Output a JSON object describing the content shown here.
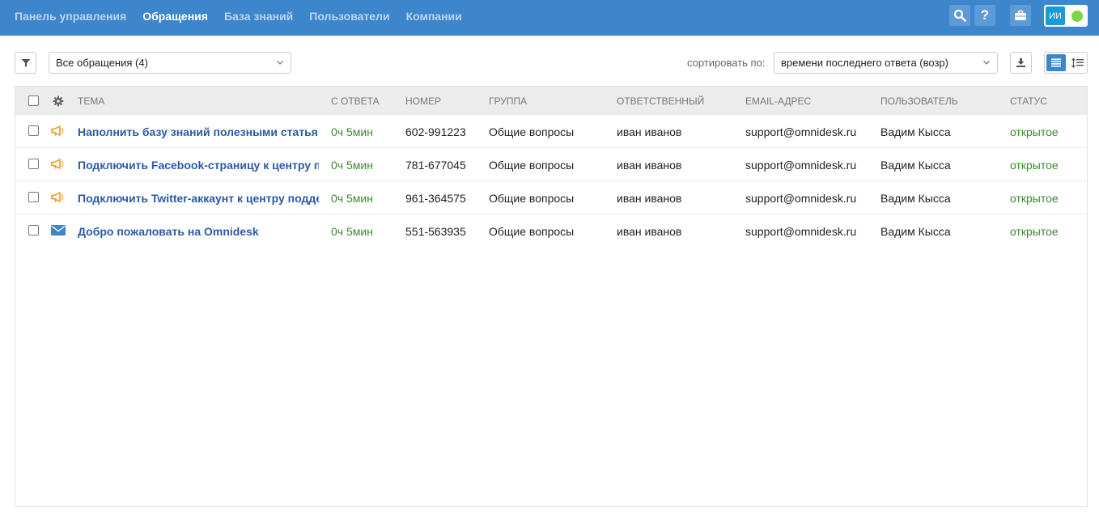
{
  "nav": {
    "items": [
      {
        "label": "Панель управления",
        "active": false
      },
      {
        "label": "Обращения",
        "active": true
      },
      {
        "label": "База знаний",
        "active": false
      },
      {
        "label": "Пользователи",
        "active": false
      },
      {
        "label": "Компании",
        "active": false
      }
    ],
    "icons": [
      "search-icon",
      "help-icon",
      "briefcase-icon"
    ]
  },
  "user": {
    "initials": "ИИ",
    "status": "online",
    "status_color": "#7ed34a"
  },
  "toolbar": {
    "filter_value": "Все обращения (4)",
    "sort_label": "сортировать по:",
    "sort_value": "времени последнего ответа (возр)"
  },
  "table": {
    "columns": [
      "ТЕМА",
      "С ОТВЕТА",
      "НОМЕР",
      "ГРУППА",
      "ОТВЕТСТВЕННЫЙ",
      "EMAIL-АДРЕС",
      "ПОЛЬЗОВАТЕЛЬ",
      "СТАТУС"
    ],
    "rows": [
      {
        "icon": "megaphone-icon",
        "subject": "Наполнить базу знаний полезными статьями",
        "since": "0ч 5мин",
        "number": "602-991223",
        "group": "Общие вопросы",
        "assignee": "иван иванов",
        "email": "support@omnidesk.ru",
        "user": "Вадим Кысса",
        "status": "открытое"
      },
      {
        "icon": "megaphone-icon",
        "subject": "Подключить Facebook-страницу к центру поддержки",
        "since": "0ч 5мин",
        "number": "781-677045",
        "group": "Общие вопросы",
        "assignee": "иван иванов",
        "email": "support@omnidesk.ru",
        "user": "Вадим Кысса",
        "status": "открытое"
      },
      {
        "icon": "megaphone-icon",
        "subject": "Подключить Twitter-аккаунт к центру поддержки",
        "since": "0ч 5мин",
        "number": "961-364575",
        "group": "Общие вопросы",
        "assignee": "иван иванов",
        "email": "support@omnidesk.ru",
        "user": "Вадим Кысса",
        "status": "открытое"
      },
      {
        "icon": "envelope-icon",
        "subject": "Добро пожаловать на Omnidesk",
        "since": "0ч 5мин",
        "number": "551-563935",
        "group": "Общие вопросы",
        "assignee": "иван иванов",
        "email": "support@omnidesk.ru",
        "user": "Вадим Кысса",
        "status": "открытое"
      }
    ]
  },
  "colors": {
    "topbar": "#3d86cc",
    "link": "#2a5aa8",
    "status_open": "#3a8a2e",
    "megaphone": "#f0a030",
    "envelope": "#3d86cc"
  }
}
